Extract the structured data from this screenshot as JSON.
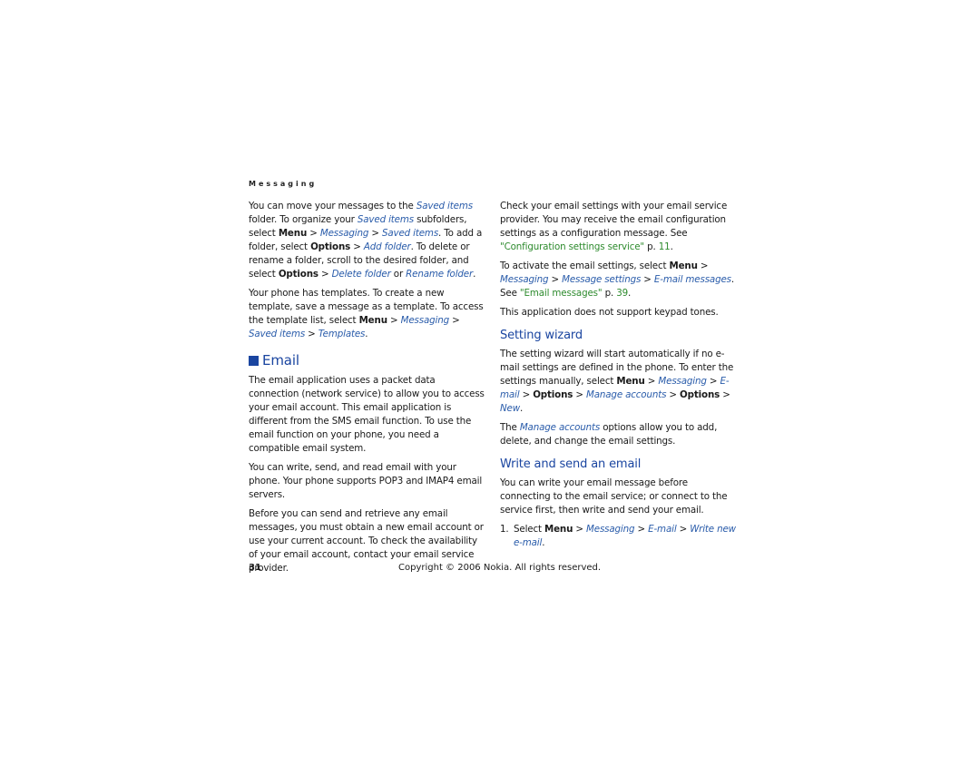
{
  "running_head": "Messaging",
  "left": {
    "p1": [
      {
        "t": "You can move your messages to the "
      },
      {
        "t": "Saved items",
        "s": "lnk"
      },
      {
        "t": " folder. To organize your "
      },
      {
        "t": "Saved items",
        "s": "lnk"
      },
      {
        "t": " subfolders, select "
      },
      {
        "t": "Menu",
        "s": "b"
      },
      {
        "t": " > "
      },
      {
        "t": "Messaging",
        "s": "lnk"
      },
      {
        "t": " > "
      },
      {
        "t": "Saved items",
        "s": "lnk"
      },
      {
        "t": ". To add a folder, select "
      },
      {
        "t": "Options",
        "s": "b"
      },
      {
        "t": " > "
      },
      {
        "t": "Add folder",
        "s": "lnk"
      },
      {
        "t": ". To delete or rename a folder, scroll to the desired folder, and select "
      },
      {
        "t": "Options",
        "s": "b"
      },
      {
        "t": " > "
      },
      {
        "t": "Delete folder",
        "s": "lnk"
      },
      {
        "t": " or "
      },
      {
        "t": "Rename folder",
        "s": "lnk"
      },
      {
        "t": "."
      }
    ],
    "p2": [
      {
        "t": "Your phone has templates. To create a new template, save a message as a template. To access the template list, select "
      },
      {
        "t": "Menu",
        "s": "b"
      },
      {
        "t": " > "
      },
      {
        "t": "Messaging",
        "s": "lnk"
      },
      {
        "t": " > "
      },
      {
        "t": "Saved items",
        "s": "lnk"
      },
      {
        "t": " > "
      },
      {
        "t": "Templates",
        "s": "lnk"
      },
      {
        "t": "."
      }
    ],
    "email_heading": "Email",
    "p3": "The email application uses a packet data connection (network service) to allow you to access your email account. This email application is different from the SMS email function. To use the email function on your phone, you need a compatible email system.",
    "p4": "You can write, send, and read email with your phone. Your phone supports POP3 and IMAP4 email servers.",
    "p5": "Before you can send and retrieve any email messages, you must obtain a new email account or use your current account. To check the availability of your email account, contact your email service provider."
  },
  "right": {
    "p1": [
      {
        "t": "Check your email settings with your email service provider. You may receive the email configuration settings as a configuration message. See "
      },
      {
        "t": "\"Configuration settings service\"",
        "s": "xref"
      },
      {
        "t": " p. "
      },
      {
        "t": "11",
        "s": "xref"
      },
      {
        "t": "."
      }
    ],
    "p2": [
      {
        "t": "To activate the email settings, select "
      },
      {
        "t": "Menu",
        "s": "b"
      },
      {
        "t": " > "
      },
      {
        "t": "Messaging",
        "s": "lnk"
      },
      {
        "t": " > "
      },
      {
        "t": "Message settings",
        "s": "lnk"
      },
      {
        "t": " > "
      },
      {
        "t": "E-mail messages",
        "s": "lnk"
      },
      {
        "t": ". See "
      },
      {
        "t": "\"Email messages\"",
        "s": "xref"
      },
      {
        "t": " p. "
      },
      {
        "t": "39",
        "s": "xref"
      },
      {
        "t": "."
      }
    ],
    "p3": "This application does not support keypad tones.",
    "setting_wizard_heading": "Setting wizard",
    "p4": [
      {
        "t": "The setting wizard will start automatically if no e-mail settings are defined in the phone. To enter the settings manually, select "
      },
      {
        "t": "Menu",
        "s": "b"
      },
      {
        "t": " > "
      },
      {
        "t": "Messaging",
        "s": "lnk"
      },
      {
        "t": " > "
      },
      {
        "t": "E-mail",
        "s": "lnk"
      },
      {
        "t": " > "
      },
      {
        "t": "Options",
        "s": "b"
      },
      {
        "t": " > "
      },
      {
        "t": "Manage accounts",
        "s": "lnk"
      },
      {
        "t": " > "
      },
      {
        "t": "Options",
        "s": "b"
      },
      {
        "t": " > "
      },
      {
        "t": "New",
        "s": "lnk"
      },
      {
        "t": "."
      }
    ],
    "p5": [
      {
        "t": "The "
      },
      {
        "t": "Manage accounts",
        "s": "lnk"
      },
      {
        "t": " options allow you to add, delete, and change the email settings."
      }
    ],
    "write_heading": "Write and send an email",
    "p6": "You can write your email message before connecting to the email service; or connect to the service first, then write and send your email.",
    "step1_num": "1.",
    "step1": [
      {
        "t": "Select "
      },
      {
        "t": "Menu",
        "s": "b"
      },
      {
        "t": " > "
      },
      {
        "t": "Messaging",
        "s": "lnk"
      },
      {
        "t": " > "
      },
      {
        "t": "E-mail",
        "s": "lnk"
      },
      {
        "t": " > "
      },
      {
        "t": "Write new e-mail",
        "s": "lnk"
      },
      {
        "t": "."
      }
    ]
  },
  "footer": {
    "page_number": "31",
    "copyright": "Copyright © 2006 Nokia. All rights reserved."
  }
}
